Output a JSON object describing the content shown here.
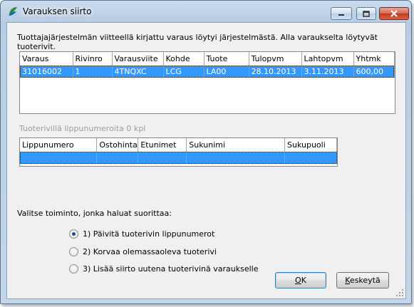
{
  "window": {
    "title": "Varauksen siirto"
  },
  "info_text": "Tuottajajärjestelmän viitteellä kirjattu varaus löytyi järjestelmästä. Alla varaukselta löytyvät tuoterivit.",
  "reservations": {
    "columns": [
      "Varaus",
      "Rivinro",
      "Varausviite",
      "Kohde",
      "Tuote",
      "Tulopvm",
      "Lahtopvm",
      "Yhtmk"
    ],
    "rows": [
      [
        "31016002",
        "1",
        "4TNQXC",
        "LCG",
        "LA00",
        "28.10.2013",
        "3.11.2013",
        "600,00"
      ]
    ]
  },
  "ticket_section_label": "Tuoterivillä lippunumeroita 0 kpl",
  "tickets": {
    "columns": [
      "Lippunumero",
      "Ostohinta",
      "Etunimet",
      "Sukunimi",
      "Sukupuoli"
    ]
  },
  "prompt": "Valitse toiminto, jonka haluat suorittaa:",
  "options": [
    {
      "label": "1) Päivitä tuoterivin lippunumerot",
      "checked": true
    },
    {
      "label": "2) Korvaa olemassaoleva tuoterivi",
      "checked": false
    },
    {
      "label": "3) Lisää siirto uutena tuoterivinä varaukselle",
      "checked": false
    }
  ],
  "buttons": {
    "ok": "OK",
    "cancel": "Keskeytä"
  },
  "colors": {
    "selection": "#3399ff",
    "titlebar": "#b8cde3"
  }
}
